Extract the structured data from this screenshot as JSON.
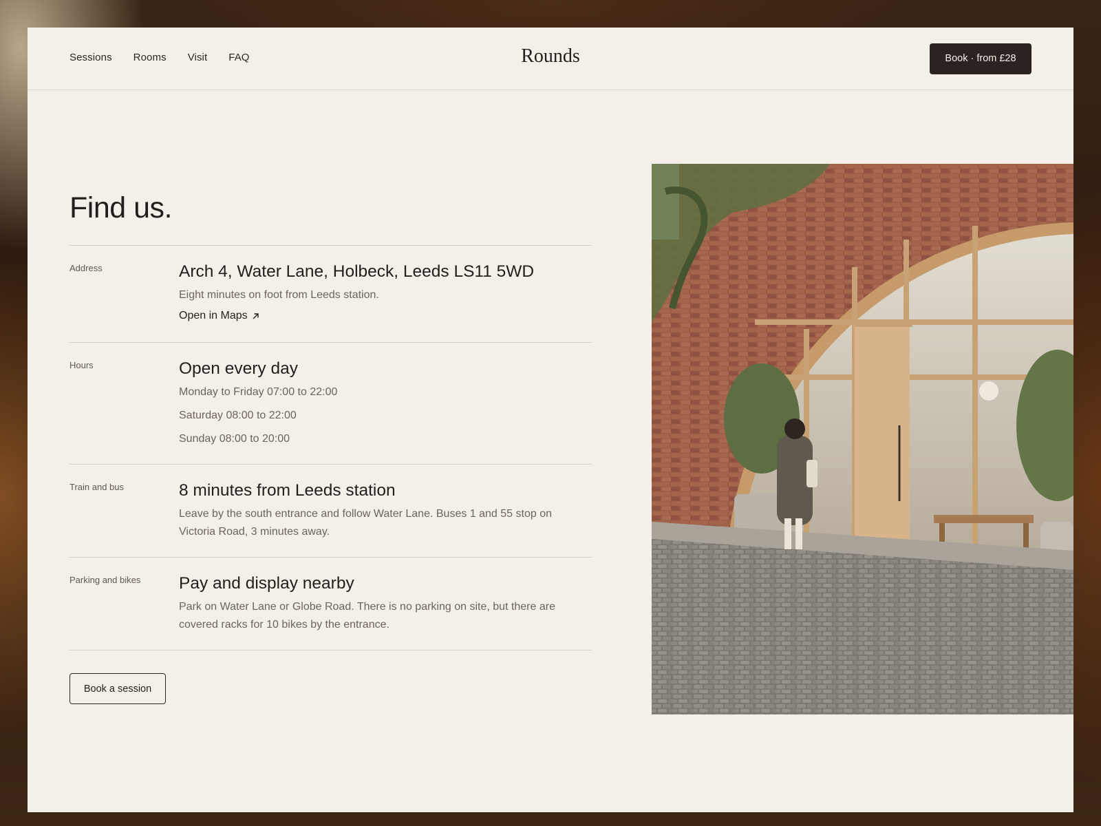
{
  "nav": {
    "items": [
      {
        "label": "Sessions"
      },
      {
        "label": "Rooms"
      },
      {
        "label": "Visit"
      },
      {
        "label": "FAQ"
      }
    ],
    "brand": "Rounds",
    "book_label": "Book · from £28"
  },
  "page": {
    "title": "Find us.",
    "sections": [
      {
        "label": "Address",
        "heading": "Arch 4, Water Lane, Holbeck, Leeds LS11 5WD",
        "lines": [
          "Eight minutes on foot from Leeds station."
        ],
        "link_label": "Open in Maps"
      },
      {
        "label": "Hours",
        "heading": "Open every day",
        "lines": [
          "Monday to Friday 07:00 to 22:00",
          "Saturday 08:00 to 22:00",
          "Sunday 08:00 to 20:00"
        ]
      },
      {
        "label": "Train and bus",
        "heading": "8 minutes from Leeds station",
        "lines": [
          "Leave by the south entrance and follow Water Lane. Buses 1 and 55 stop on Victoria Road, 3 minutes away."
        ]
      },
      {
        "label": "Parking and bikes",
        "heading": "Pay and display nearby",
        "lines": [
          "Park on Water Lane or Globe Road. There is no parking on site, but there are covered racks for 10 bikes by the entrance."
        ]
      }
    ],
    "cta_label": "Book a session"
  },
  "icons": {
    "external_link": "arrow-up-right-icon"
  },
  "colors": {
    "page_bg": "#f4f0e9",
    "ink": "#221e1b",
    "muted": "#6b645d",
    "button_dark": "#2a2320",
    "rule": "#d9d1c5"
  }
}
